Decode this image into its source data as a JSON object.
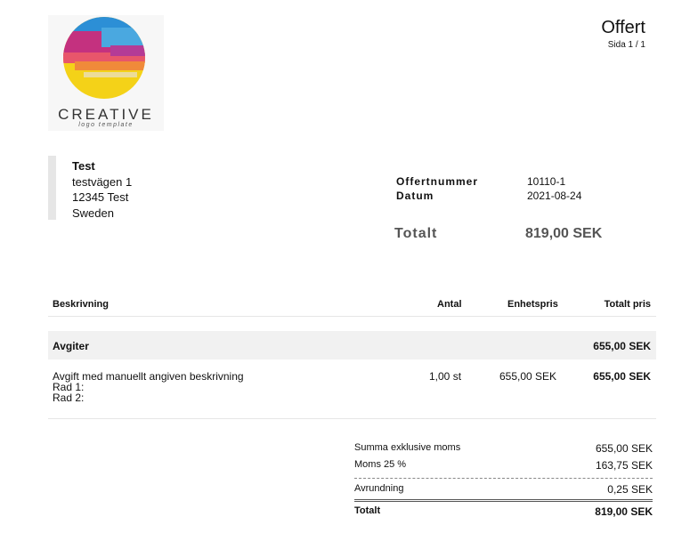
{
  "logo": {
    "text": "CREATIVE",
    "subtext": "logo template"
  },
  "document": {
    "title": "Offert",
    "page": "Sida 1 / 1"
  },
  "recipient": {
    "name": "Test",
    "street": "testvägen 1",
    "city": "12345 Test",
    "country": "Sweden"
  },
  "meta": {
    "offer_number_label": "Offertnummer",
    "offer_number": "10110-1",
    "date_label": "Datum",
    "date": "2021-08-24",
    "total_label": "Totalt",
    "total": "819,00 SEK"
  },
  "table": {
    "headers": {
      "description": "Beskrivning",
      "quantity": "Antal",
      "unit_price": "Enhetspris",
      "total_price": "Totalt pris"
    },
    "group": {
      "label": "Avgiter",
      "total": "655,00 SEK"
    },
    "item": {
      "description": "Avgift med manuellt angiven beskrivning",
      "line2": "Rad 1:",
      "line3": "Rad 2:",
      "quantity": "1,00 st",
      "unit_price": "655,00 SEK",
      "total": "655,00 SEK"
    }
  },
  "summary": {
    "excl_label": "Summa exklusive moms",
    "excl_value": "655,00 SEK",
    "vat_label": "Moms 25 %",
    "vat_value": "163,75 SEK",
    "rounding_label": "Avrundning",
    "rounding_value": "0,25 SEK",
    "total_label": "Totalt",
    "total_value": "819,00 SEK"
  }
}
